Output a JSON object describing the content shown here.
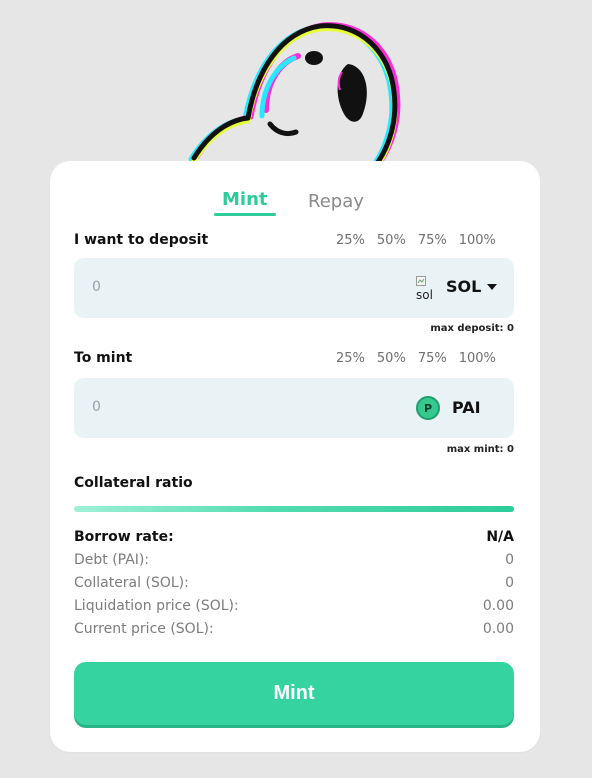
{
  "tabs": {
    "mint_label": "Mint",
    "repay_label": "Repay"
  },
  "deposit": {
    "label": "I want to deposit",
    "percents": [
      "25%",
      "50%",
      "75%",
      "100%"
    ],
    "value": "0",
    "token_img_alt": "sol",
    "token_label": "SOL",
    "max_text": "max deposit: 0"
  },
  "mint_field": {
    "label": "To mint",
    "percents": [
      "25%",
      "50%",
      "75%",
      "100%"
    ],
    "value": "0",
    "token_icon_letter": "P",
    "token_label": "PAI",
    "max_text": "max mint: 0"
  },
  "collateral": {
    "label": "Collateral ratio"
  },
  "stats": {
    "borrow_rate_label": "Borrow rate:",
    "borrow_rate_value": "N/A",
    "debt_label": "Debt (PAI):",
    "debt_value": "0",
    "collateral_label": "Collateral (SOL):",
    "collateral_value": "0",
    "liquidation_label": "Liquidation price (SOL):",
    "liquidation_value": "0.00",
    "current_label": "Current price (SOL):",
    "current_value": "0.00"
  },
  "action": {
    "button_label": "Mint"
  },
  "colors": {
    "accent": "#2ecc9a",
    "button": "#34d39f",
    "input_bg": "#e9f3f6"
  }
}
